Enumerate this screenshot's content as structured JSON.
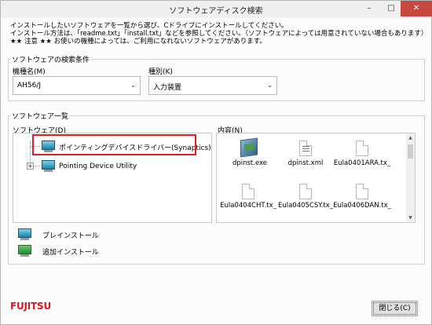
{
  "window": {
    "title": "ソフトウェアディスク検索"
  },
  "titlebar": {
    "min": "–",
    "max": "□",
    "close": "✕"
  },
  "instructions": [
    "インストールしたいソフトウェアを一覧から選び、Cドライブにインストールしてください。",
    "インストール方法は、「readme.txt」「install.txt」などを参照してください。（ソフトウェアによっては用意されていない場合もあります）",
    "★★ 注意 ★★ お使いの機種によっては、ご利用になれないソフトウェアがあります。"
  ],
  "search_conditions": {
    "group_title": "ソフトウェアの検索条件",
    "model_label": "機種名(M)",
    "model_value": "AH56/J",
    "type_label": "種別(K)",
    "type_value": "入力装置"
  },
  "software_list": {
    "group_title": "ソフトウェア一覧",
    "tree_label": "ソフトウェア(D)",
    "content_label": "内容(N)",
    "tree_items": [
      {
        "label": "ポインティングデバイスドライバー(Synaptics)",
        "expander": "",
        "selected": true
      },
      {
        "label": "Pointing Device Utility",
        "expander": "+",
        "selected": false
      }
    ],
    "files": [
      {
        "name": "dpinst.exe",
        "icon": "exe-icon"
      },
      {
        "name": "dpinst.xml",
        "icon": "xml-file-icon"
      },
      {
        "name": "Eula0401ARA.tx_",
        "icon": "file-icon"
      },
      {
        "name": "Eula0404CHT.tx_",
        "icon": "file-icon"
      },
      {
        "name": "Eula0405CSY.tx_",
        "icon": "file-icon"
      },
      {
        "name": "Eula0406DAN.tx_",
        "icon": "file-icon"
      }
    ]
  },
  "legend": {
    "preinstall": "プレインストール",
    "addinstall": "追加インストール"
  },
  "footer": {
    "brand": "FUJITSU",
    "close_button": "閉じる(C)"
  },
  "colors": {
    "highlight_border": "#e02020",
    "brand_red": "#d71a21",
    "close_button_red": "#c7483f"
  }
}
